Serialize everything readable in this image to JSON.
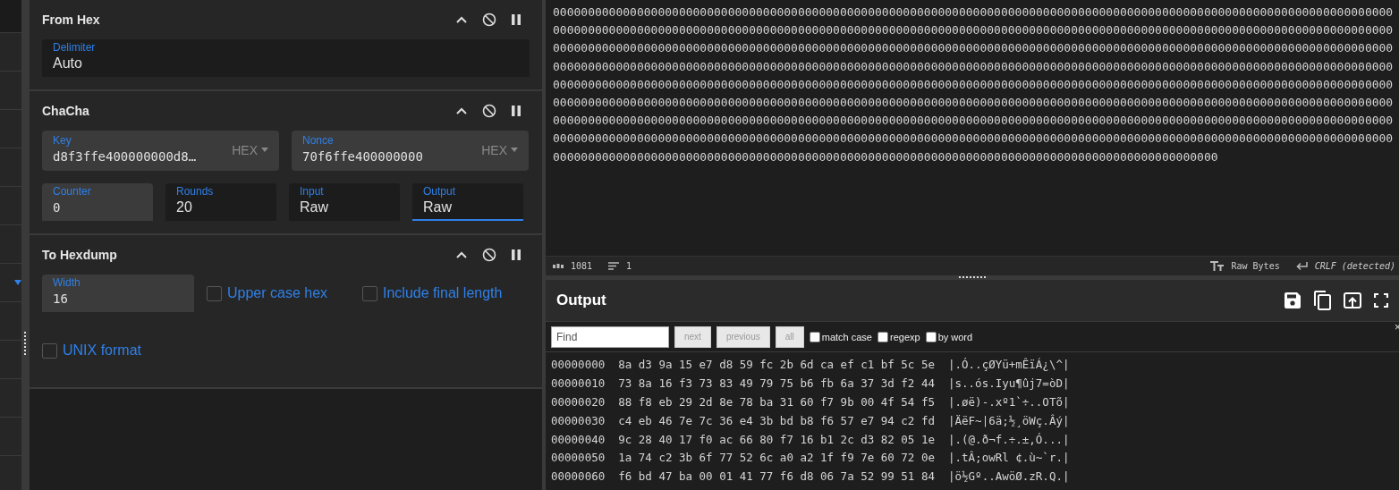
{
  "recipe": [
    {
      "title": "From Hex",
      "args": [
        {
          "kind": "option",
          "label": "Delimiter",
          "value": "Auto",
          "focused": false
        }
      ]
    },
    {
      "title": "ChaCha",
      "args": [
        {
          "kind": "toggle",
          "label": "Key",
          "value": "d8f3ffe400000000d8…",
          "toggle": "HEX",
          "focused": false
        },
        {
          "kind": "toggle",
          "label": "Nonce",
          "value": "70f6ffe400000000",
          "toggle": "HEX",
          "focused": false
        },
        {
          "kind": "number",
          "label": "Counter",
          "value": "0",
          "focused": false
        },
        {
          "kind": "option",
          "label": "Rounds",
          "value": "20",
          "focused": false
        },
        {
          "kind": "option",
          "label": "Input",
          "value": "Raw",
          "focused": false
        },
        {
          "kind": "option",
          "label": "Output",
          "value": "Raw",
          "focused": true
        }
      ]
    },
    {
      "title": "To Hexdump",
      "args": [
        {
          "kind": "number",
          "label": "Width",
          "value": "16",
          "focused": false
        },
        {
          "kind": "checkbox",
          "label": "Upper case hex",
          "checked": false
        },
        {
          "kind": "checkbox",
          "label": "Include final length",
          "checked": false
        },
        {
          "kind": "checkbox",
          "label": "UNIX format",
          "checked": false
        }
      ]
    }
  ],
  "input": {
    "lines": [
      "000000000000000000000000000000000000000000000000000000000000000000000000000000000000000000000000000000000000000000000000",
      "000000000000000000000000000000000000000000000000000000000000000000000000000000000000000000000000000000000000000000000000",
      "000000000000000000000000000000000000000000000000000000000000000000000000000000000000000000000000000000000000000000000000",
      "000000000000000000000000000000000000000000000000000000000000000000000000000000000000000000000000000000000000000000000000",
      "000000000000000000000000000000000000000000000000000000000000000000000000000000000000000000000000000000000000000000000000",
      "000000000000000000000000000000000000000000000000000000000000000000000000000000000000000000000000000000000000000000000000",
      "000000000000000000000000000000000000000000000000000000000000000000000000000000000000000000000000000000000000000000000000",
      "000000000000000000000000000000000000000000000000000000000000000000000000000000000000000000000000000000000000000000000000",
      "00000000000000000000000000000000000000000000000000000000000000000000000000000000000000000000000"
    ],
    "status": {
      "chars": "1081",
      "lines": "1",
      "encoding": "Raw Bytes",
      "eol": "CRLF (detected)"
    }
  },
  "output": {
    "title": "Output",
    "find": {
      "placeholder": "Find",
      "buttons": [
        "next",
        "previous",
        "all"
      ],
      "options": [
        {
          "label": "match case",
          "checked": false
        },
        {
          "label": "regexp",
          "checked": false
        },
        {
          "label": "by word",
          "checked": false
        }
      ],
      "close": "×"
    },
    "hexdump": [
      "00000000  8a d3 9a 15 e7 d8 59 fc 2b 6d ca ef c1 bf 5c 5e  |.Ó..çØYü+mÊïÁ¿\\^|",
      "00000010  73 8a 16 f3 73 83 49 79 75 b6 fb 6a 37 3d f2 44  |s..ós.Iyu¶ûj7=òD|",
      "00000020  88 f8 eb 29 2d 8e 78 ba 31 60 f7 9b 00 4f 54 f5  |.øë)-.xº1`÷..OTõ|",
      "00000030  c4 eb 46 7e 7c 36 e4 3b bd b8 f6 57 e7 94 c2 fd  |ÄëF~|6ä;½¸öWç.Âý|",
      "00000040  9c 28 40 17 f0 ac 66 80 f7 16 b1 2c d3 82 05 1e  |.(@.ð¬f.÷.±,Ó...|",
      "00000050  1a 74 c2 3b 6f 77 52 6c a0 a2 1f f9 7e 60 72 0e  |.tÂ;owRl ¢.ù~`r.|",
      "00000060  f6 bd 47 ba 00 01 41 77 f6 d8 06 7a 52 99 51 84  |ö½Gº..AwöØ.zR.Q.|"
    ]
  }
}
